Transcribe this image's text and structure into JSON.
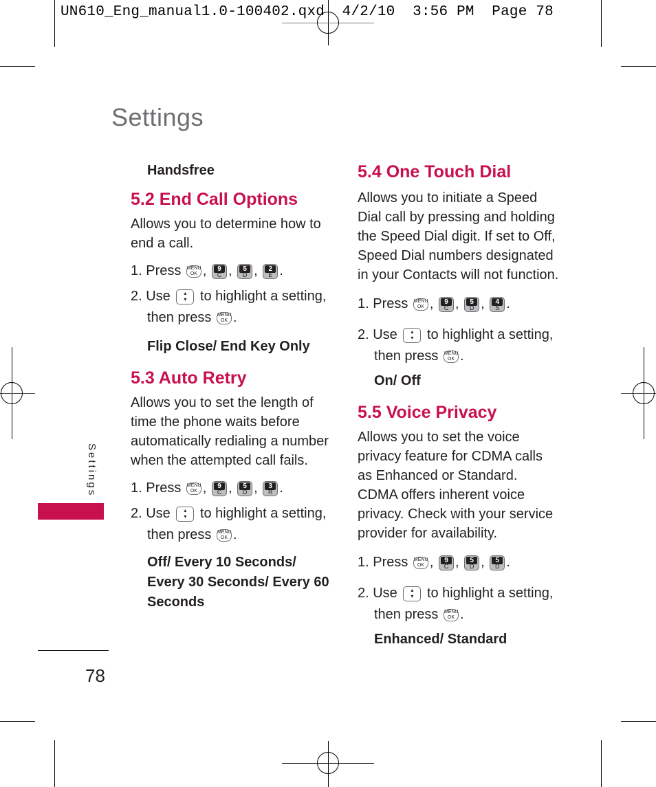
{
  "slug_line": "UN610_Eng_manual1.0-100402.qxd  4/2/10  3:56 PM  Page 78",
  "page_title": "Settings",
  "side_tab": {
    "label": "Settings",
    "color": "#c8104e"
  },
  "page_number": "78",
  "accent_color": "#c8104e",
  "left_column": {
    "top_option": "Handsfree",
    "sections": [
      {
        "heading": "5.2 End Call Options",
        "description": "Allows you to determine how to end a call.",
        "step1_prefix": "1. Press",
        "step1_keys": [
          {
            "num": "9",
            "letter": "C"
          },
          {
            "num": "5",
            "letter": "D"
          },
          {
            "num": "2",
            "letter": "E"
          }
        ],
        "step2_a": "2. Use",
        "step2_b": "to highlight a setting, then press",
        "options": "Flip Close/ End Key Only"
      },
      {
        "heading": "5.3 Auto Retry",
        "description": "Allows you to set the length of time the phone waits before automatically redialing a number when the attempted call fails.",
        "step1_prefix": "1. Press",
        "step1_keys": [
          {
            "num": "9",
            "letter": "C"
          },
          {
            "num": "5",
            "letter": "D"
          },
          {
            "num": "3",
            "letter": "R"
          }
        ],
        "step2_a": "2. Use",
        "step2_b": "to highlight a setting, then press",
        "options": "Off/ Every 10 Seconds/ Every 30 Seconds/ Every 60 Seconds"
      }
    ]
  },
  "right_column": {
    "sections": [
      {
        "heading": "5.4 One Touch Dial",
        "description": "Allows you to initiate a Speed Dial call by pressing and holding the Speed Dial digit. If set to Off, Speed Dial numbers designated in your Contacts will not function.",
        "step1_prefix": "1. Press",
        "step1_keys": [
          {
            "num": "9",
            "letter": "C"
          },
          {
            "num": "5",
            "letter": "D"
          },
          {
            "num": "4",
            "letter": "S"
          }
        ],
        "step2_a": "2. Use",
        "step2_b": "to highlight a setting, then press",
        "options": "On/ Off"
      },
      {
        "heading": "5.5 Voice Privacy",
        "description": "Allows you to set the voice privacy feature for CDMA calls as Enhanced or Standard. CDMA offers inherent voice privacy. Check with your service provider for availability.",
        "step1_prefix": "1. Press",
        "step1_keys": [
          {
            "num": "9",
            "letter": "C"
          },
          {
            "num": "5",
            "letter": "D"
          },
          {
            "num": "5",
            "letter": "D"
          }
        ],
        "step2_a": "2. Use",
        "step2_b": "to highlight a setting, then press",
        "options": "Enhanced/ Standard"
      }
    ]
  },
  "icons": {
    "menu_ok": "MENU\nOK",
    "nav_key": "up-down-navigation-key"
  }
}
